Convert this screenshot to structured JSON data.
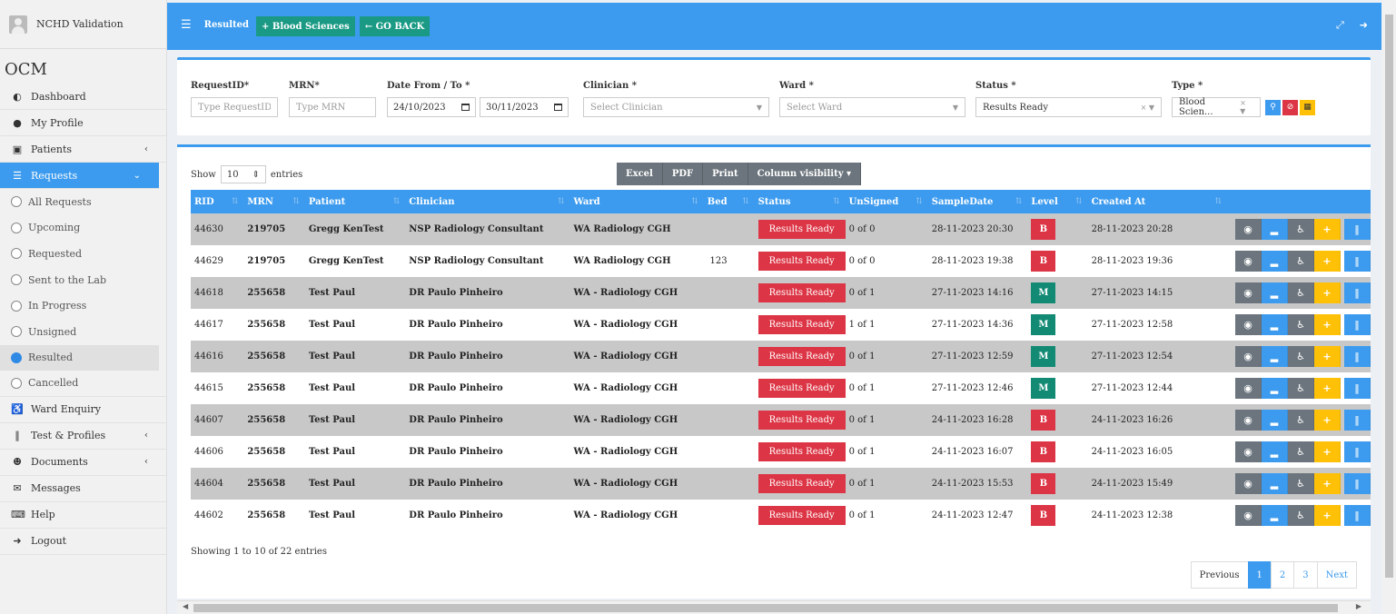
{
  "user": {
    "name": "NCHD Validation"
  },
  "brand": "OCM",
  "menu": {
    "dashboard": "Dashboard",
    "my_profile": "My Profile",
    "patients": "Patients",
    "requests": "Requests",
    "sub": [
      "All Requests",
      "Upcoming",
      "Requested",
      "Sent to the Lab",
      "In Progress",
      "Unsigned",
      "Resulted",
      "Cancelled"
    ],
    "ward_enquiry": "Ward Enquiry",
    "test_profiles": "Test & Profiles",
    "documents": "Documents",
    "messages": "Messages",
    "help": "Help",
    "logout": "Logout"
  },
  "topbar": {
    "crumb": "Resulted",
    "blood_btn": "+ Blood Sciences",
    "back_btn": "← GO BACK"
  },
  "filters": {
    "request_id": {
      "label": "RequestID*",
      "placeholder": "Type RequestID"
    },
    "mrn": {
      "label": "MRN*",
      "placeholder": "Type MRN"
    },
    "date": {
      "label": "Date From / To *",
      "from": "24/10/2023",
      "to": "30/11/2023"
    },
    "clinician": {
      "label": "Clinician *",
      "placeholder": "Select Clinician"
    },
    "ward": {
      "label": "Ward *",
      "placeholder": "Select Ward"
    },
    "status": {
      "label": "Status *",
      "value": "Results Ready"
    },
    "type": {
      "label": "Type *",
      "value": "Blood Scien..."
    }
  },
  "table_controls": {
    "show": "Show",
    "length": "10",
    "entries": "entries",
    "buttons": [
      "Excel",
      "PDF",
      "Print",
      "Column visibility"
    ]
  },
  "columns": [
    "RID",
    "MRN",
    "Patient",
    "Clinician",
    "Ward",
    "Bed",
    "Status",
    "UnSigned",
    "SampleDate",
    "Level",
    "Created At"
  ],
  "rows": [
    {
      "rid": "44630",
      "mrn": "219705",
      "patient": "Gregg KenTest",
      "clinician": "NSP Radiology Consultant",
      "ward": "WA Radiology CGH",
      "bed": "",
      "status": "Results Ready",
      "unsigned": "0 of 0",
      "sample": "28-11-2023 20:30",
      "level": "B",
      "created": "28-11-2023 20:28"
    },
    {
      "rid": "44629",
      "mrn": "219705",
      "patient": "Gregg KenTest",
      "clinician": "NSP Radiology Consultant",
      "ward": "WA Radiology CGH",
      "bed": "123",
      "status": "Results Ready",
      "unsigned": "0 of 0",
      "sample": "28-11-2023 19:38",
      "level": "B",
      "created": "28-11-2023 19:36"
    },
    {
      "rid": "44618",
      "mrn": "255658",
      "patient": "Test Paul",
      "clinician": "DR Paulo Pinheiro",
      "ward": "WA - Radiology CGH",
      "bed": "",
      "status": "Results Ready",
      "unsigned": "0 of 1",
      "sample": "27-11-2023 14:16",
      "level": "M",
      "created": "27-11-2023 14:15"
    },
    {
      "rid": "44617",
      "mrn": "255658",
      "patient": "Test Paul",
      "clinician": "DR Paulo Pinheiro",
      "ward": "WA - Radiology CGH",
      "bed": "",
      "status": "Results Ready",
      "unsigned": "1 of 1",
      "sample": "27-11-2023 14:36",
      "level": "M",
      "created": "27-11-2023 12:58"
    },
    {
      "rid": "44616",
      "mrn": "255658",
      "patient": "Test Paul",
      "clinician": "DR Paulo Pinheiro",
      "ward": "WA - Radiology CGH",
      "bed": "",
      "status": "Results Ready",
      "unsigned": "0 of 1",
      "sample": "27-11-2023 12:59",
      "level": "M",
      "created": "27-11-2023 12:54"
    },
    {
      "rid": "44615",
      "mrn": "255658",
      "patient": "Test Paul",
      "clinician": "DR Paulo Pinheiro",
      "ward": "WA - Radiology CGH",
      "bed": "",
      "status": "Results Ready",
      "unsigned": "0 of 1",
      "sample": "27-11-2023 12:46",
      "level": "M",
      "created": "27-11-2023 12:44"
    },
    {
      "rid": "44607",
      "mrn": "255658",
      "patient": "Test Paul",
      "clinician": "DR Paulo Pinheiro",
      "ward": "WA - Radiology CGH",
      "bed": "",
      "status": "Results Ready",
      "unsigned": "0 of 1",
      "sample": "24-11-2023 16:28",
      "level": "B",
      "created": "24-11-2023 16:26"
    },
    {
      "rid": "44606",
      "mrn": "255658",
      "patient": "Test Paul",
      "clinician": "DR Paulo Pinheiro",
      "ward": "WA - Radiology CGH",
      "bed": "",
      "status": "Results Ready",
      "unsigned": "0 of 1",
      "sample": "24-11-2023 16:07",
      "level": "B",
      "created": "24-11-2023 16:05"
    },
    {
      "rid": "44604",
      "mrn": "255658",
      "patient": "Test Paul",
      "clinician": "DR Paulo Pinheiro",
      "ward": "WA - Radiology CGH",
      "bed": "",
      "status": "Results Ready",
      "unsigned": "0 of 1",
      "sample": "24-11-2023 15:53",
      "level": "B",
      "created": "24-11-2023 15:49"
    },
    {
      "rid": "44602",
      "mrn": "255658",
      "patient": "Test Paul",
      "clinician": "DR Paulo Pinheiro",
      "ward": "WA - Radiology CGH",
      "bed": "",
      "status": "Results Ready",
      "unsigned": "0 of 1",
      "sample": "24-11-2023 12:47",
      "level": "B",
      "created": "24-11-2023 12:38"
    }
  ],
  "info": "Showing 1 to 10 of 22 entries",
  "pagination": {
    "prev": "Previous",
    "pages": [
      "1",
      "2",
      "3"
    ],
    "next": "Next"
  },
  "colors": {
    "primary": "#3c9bee",
    "teal": "#1a9a84",
    "danger": "#dc3545",
    "level_m": "#128a74",
    "warning": "#ffc107",
    "secondary": "#6c757d"
  }
}
